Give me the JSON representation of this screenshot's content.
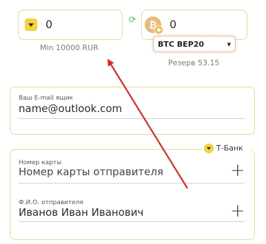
{
  "exchange": {
    "from": {
      "amount": "0",
      "min_note": "Min 10000 RUR"
    },
    "swap_icon": "refresh-icon",
    "to": {
      "amount": "0",
      "coin_symbol": "₿",
      "currency_select": "BTC BEP20",
      "reserve_note": "Резерв 53.15"
    }
  },
  "email": {
    "label": "Ваш E-mail ящик",
    "value": "name@outlook.com"
  },
  "card": {
    "bank_name": "Т-Банк",
    "number_label": "Номер карты",
    "number_value": "Номер карты отправителя",
    "holder_label": "Ф.И.О. отправителя",
    "holder_value": "Иванов Иван Иванович"
  },
  "colors": {
    "accent_border": "#f0d98c",
    "badge": "#f4d23a",
    "arrow": "#e82020",
    "swap": "#5fbf5a"
  }
}
